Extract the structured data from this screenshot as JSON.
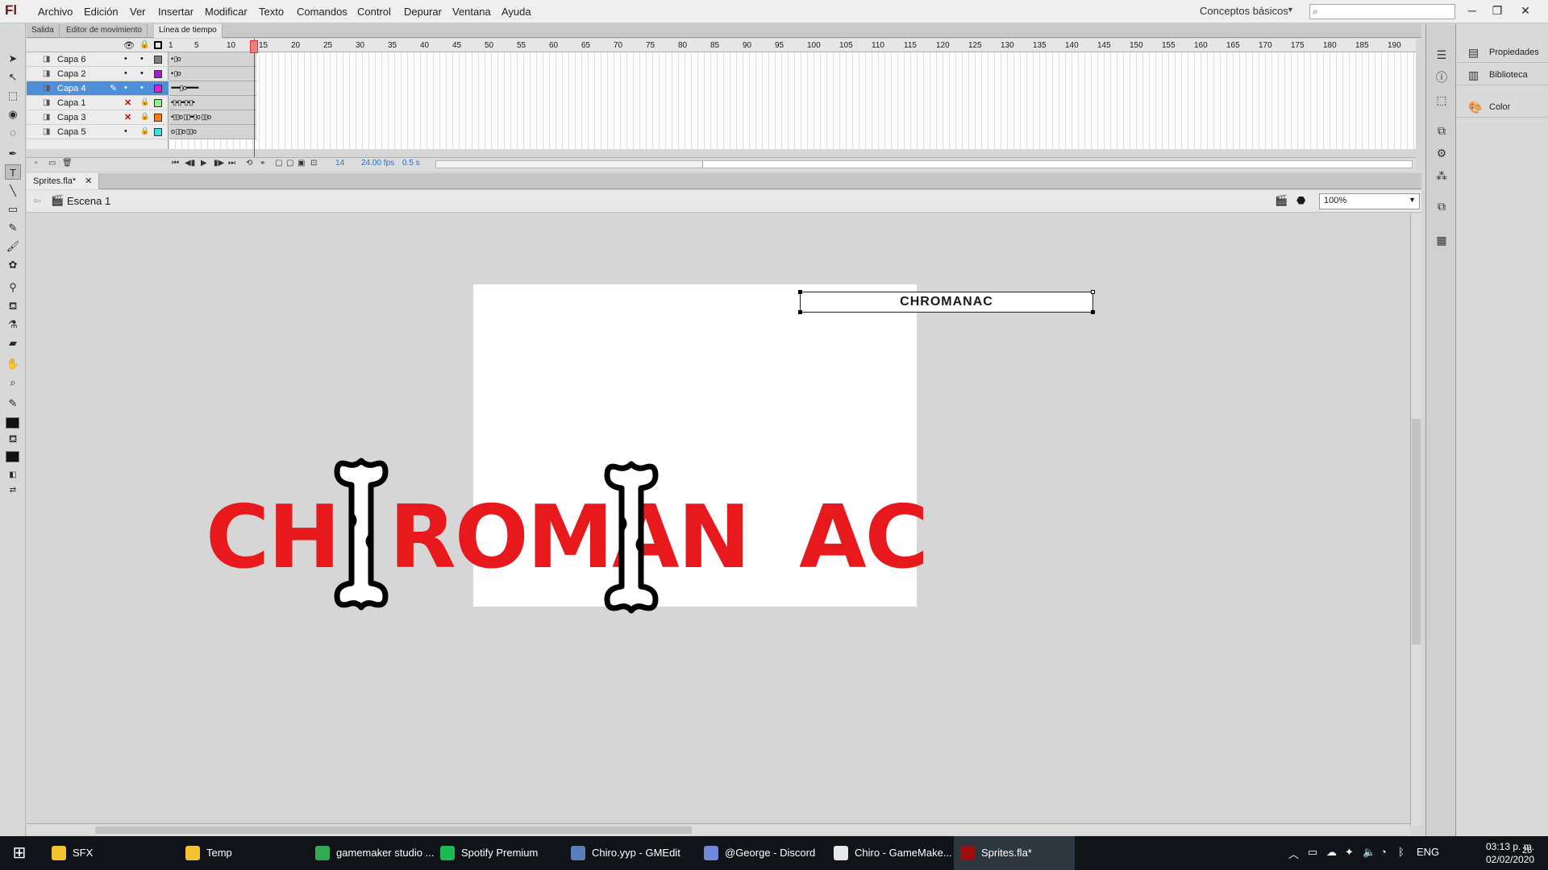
{
  "app": {
    "logo": "Fl"
  },
  "menu": [
    "Archivo",
    "Edición",
    "Ver",
    "Insertar",
    "Modificar",
    "Texto",
    "Comandos",
    "Control",
    "Depurar",
    "Ventana",
    "Ayuda"
  ],
  "workspace": {
    "label": "Conceptos básicos",
    "search_placeholder": ""
  },
  "window_controls": {
    "minimize": "─",
    "restore": "❐",
    "close": "✕"
  },
  "panel_tabs": [
    "Salida",
    "Editor de movimiento",
    "Línea de tiempo"
  ],
  "timeline": {
    "ruler": [
      "1",
      "5",
      "10",
      "15",
      "20",
      "25",
      "30",
      "35",
      "40",
      "45",
      "50",
      "55",
      "60",
      "65",
      "70",
      "75",
      "80",
      "85",
      "90",
      "95",
      "100",
      "105",
      "110",
      "115",
      "120",
      "125",
      "130",
      "135",
      "140",
      "145",
      "150",
      "155",
      "160",
      "165",
      "170",
      "175",
      "180",
      "185",
      "190"
    ],
    "layers": [
      {
        "name": "Capa 6",
        "color": "#808080",
        "keys": "• ▯o"
      },
      {
        "name": "Capa 2",
        "color": "#a020c0",
        "keys": "• ▯o"
      },
      {
        "name": "Capa 4",
        "color": "#e020e0",
        "keys": "•••••▯o•••••••"
      },
      {
        "name": "Capa 1",
        "color": "#90f090",
        "keys": "•▯•▯••▯•▯•"
      },
      {
        "name": "Capa 3",
        "color": "#ff7a10",
        "keys": "•▯▯o ▯▯••▯o ▯▯o"
      },
      {
        "name": "Capa 5",
        "color": "#40e0e0",
        "keys": "o ▯▯o ▯▯o"
      }
    ],
    "current_frame": "14",
    "fps": "24.00 fps",
    "time": "0.5 s"
  },
  "document": {
    "tab": "Sprites.fla*",
    "scene": "Escena 1",
    "zoom": "100%"
  },
  "stage": {
    "text_field": "CHROMANAC",
    "logo_left": "CH",
    "logo_mid": "ROMAN",
    "logo_right": "AC"
  },
  "dock": {
    "panels": [
      "Propiedades",
      "Biblioteca",
      "Color"
    ]
  },
  "taskbar": {
    "tasks": [
      {
        "label": "SFX",
        "color": "#f2c230"
      },
      {
        "label": "Temp",
        "color": "#f2c230"
      },
      {
        "label": "gamemaker studio ...",
        "color": "#34a853"
      },
      {
        "label": "Spotify Premium",
        "color": "#1db954"
      },
      {
        "label": "Chiro.yyp - GMEdit",
        "color": "#5a7fb8"
      },
      {
        "label": "@George - Discord",
        "color": "#7289da"
      },
      {
        "label": "Chiro - GameMake...",
        "color": "#e8e8e8"
      },
      {
        "label": "Sprites.fla*",
        "color": "#9a1010"
      }
    ],
    "lang": "ENG",
    "time": "03:13 p. m.",
    "date": "02/02/2020",
    "notifications": "26"
  }
}
